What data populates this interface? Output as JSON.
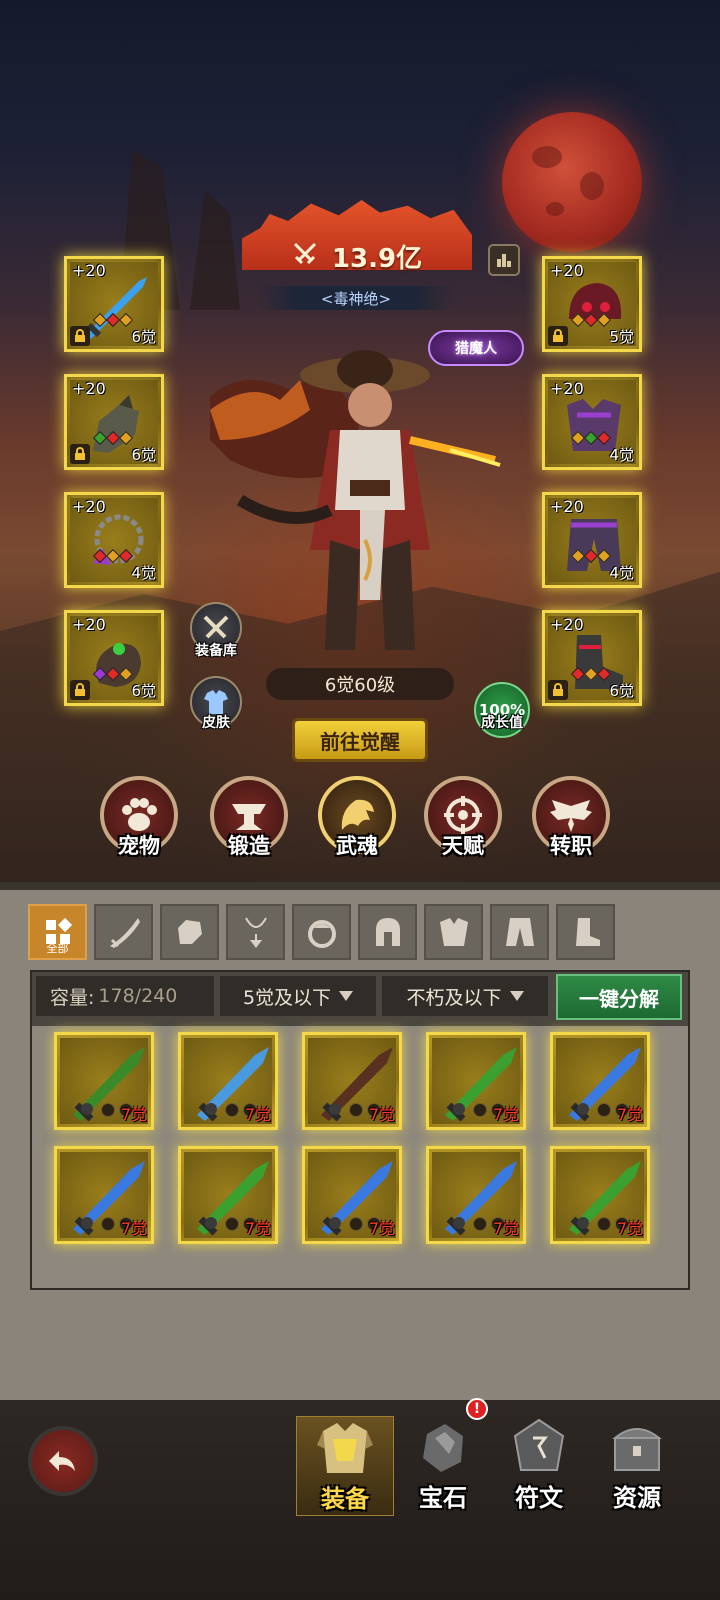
{
  "hero": {
    "power": "13.9亿",
    "title": "<毒神绝>",
    "badge": "猎魔人",
    "level_text": "6觉60级",
    "awaken_button": "前往觉醒",
    "growth_value": "100%",
    "growth_label": "成长值",
    "armory_label": "装备库",
    "skin_label": "皮肤"
  },
  "equipped": {
    "left": [
      {
        "level": "+20",
        "awaken": "6觉",
        "locked": true,
        "icon": "sword-blue-icon"
      },
      {
        "level": "+20",
        "awaken": "6觉",
        "locked": true,
        "icon": "gauntlet-icon"
      },
      {
        "level": "+20",
        "awaken": "4觉",
        "locked": false,
        "icon": "necklace-icon"
      },
      {
        "level": "+20",
        "awaken": "6觉",
        "locked": true,
        "icon": "ring-icon"
      }
    ],
    "right": [
      {
        "level": "+20",
        "awaken": "5觉",
        "locked": true,
        "icon": "helmet-icon"
      },
      {
        "level": "+20",
        "awaken": "4觉",
        "locked": false,
        "icon": "chest-armor-icon"
      },
      {
        "level": "+20",
        "awaken": "4觉",
        "locked": false,
        "icon": "pants-icon"
      },
      {
        "level": "+20",
        "awaken": "6觉",
        "locked": true,
        "icon": "boots-icon"
      }
    ]
  },
  "functions": [
    {
      "label": "宠物",
      "icon": "paw-icon"
    },
    {
      "label": "锻造",
      "icon": "anvil-icon"
    },
    {
      "label": "武魂",
      "icon": "dragon-icon"
    },
    {
      "label": "天赋",
      "icon": "talent-icon"
    },
    {
      "label": "转职",
      "icon": "wings-icon"
    }
  ],
  "tabs": {
    "all_label": "全部"
  },
  "inventory": {
    "capacity_label": "容量:",
    "capacity_value": "178/240",
    "filter1": "5觉及以下",
    "filter2": "不朽及以下",
    "decompose_button": "一键分解",
    "items": [
      {
        "awaken": "7觉",
        "color": "#3a8a2a"
      },
      {
        "awaken": "7觉",
        "color": "#4a9ae0"
      },
      {
        "awaken": "7觉",
        "color": "#5a3020"
      },
      {
        "awaken": "7觉",
        "color": "#3aa030"
      },
      {
        "awaken": "7觉",
        "color": "#3a7ae0"
      },
      {
        "awaken": "7觉",
        "color": "#3a7ae0"
      },
      {
        "awaken": "7觉",
        "color": "#3aa030"
      },
      {
        "awaken": "7觉",
        "color": "#3a7ae0"
      },
      {
        "awaken": "7觉",
        "color": "#3a7ae0"
      },
      {
        "awaken": "7觉",
        "color": "#3aa030"
      }
    ]
  },
  "bottom_nav": [
    {
      "label": "装备",
      "active": true
    },
    {
      "label": "宝石",
      "active": false,
      "badge": "!"
    },
    {
      "label": "符文",
      "active": false
    },
    {
      "label": "资源",
      "active": false
    }
  ]
}
